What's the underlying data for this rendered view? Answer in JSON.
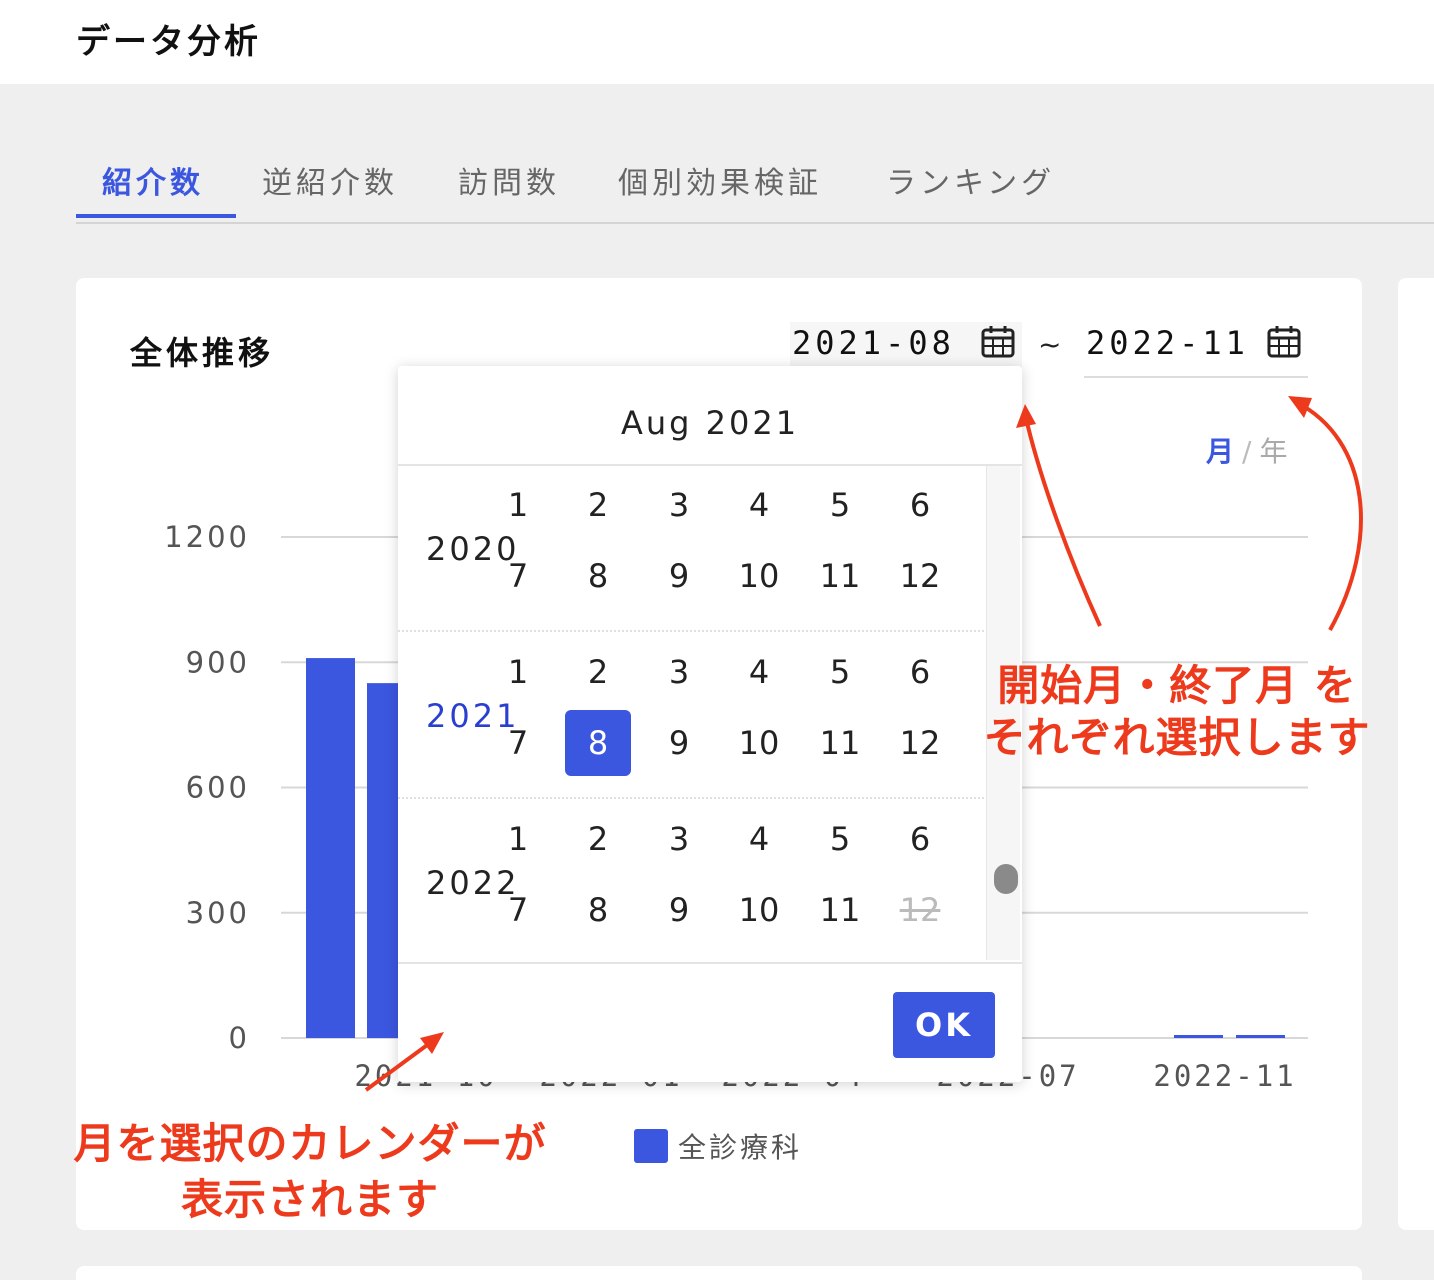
{
  "app": {
    "title": "データ分析"
  },
  "tabs": [
    {
      "label": "紹介数",
      "active": true
    },
    {
      "label": "逆紹介数",
      "active": false
    },
    {
      "label": "訪問数",
      "active": false
    },
    {
      "label": "個別効果検証",
      "active": false
    },
    {
      "label": "ランキング",
      "active": false
    }
  ],
  "card": {
    "title": "全体推移",
    "range": {
      "start": "2021-08",
      "separator": "~",
      "end": "2022-11"
    },
    "period_toggle": {
      "month": "月",
      "divider": "/",
      "year": "年",
      "selected": "月"
    }
  },
  "chart_data": {
    "type": "bar",
    "y_ticks": [
      "1200",
      "900",
      "600",
      "300",
      "0"
    ],
    "ylim": [
      0,
      1200
    ],
    "x_ticks": [
      "2021-10",
      "2022-01",
      "2022-04",
      "2022-07",
      "2022-11"
    ],
    "visible_values": [
      {
        "x": "2021-08",
        "y": 910
      },
      {
        "x": "2021-09",
        "y": 850
      },
      {
        "x": "2022-10",
        "y": 0
      },
      {
        "x": "2022-11",
        "y": 0
      }
    ],
    "series": [
      {
        "name": "全診療科",
        "color": "#3b57e0"
      }
    ],
    "grid": true,
    "legend": "bottom-center"
  },
  "calendar": {
    "header": "Aug 2021",
    "years": [
      {
        "year": "2020",
        "months": [
          "1",
          "2",
          "3",
          "4",
          "5",
          "6",
          "7",
          "8",
          "9",
          "10",
          "11",
          "12"
        ]
      },
      {
        "year": "2021",
        "months": [
          "1",
          "2",
          "3",
          "4",
          "5",
          "6",
          "7",
          "8",
          "9",
          "10",
          "11",
          "12"
        ],
        "current": true,
        "selected_month": "8"
      },
      {
        "year": "2022",
        "months": [
          "1",
          "2",
          "3",
          "4",
          "5",
          "6",
          "7",
          "8",
          "9",
          "10",
          "11",
          "12"
        ],
        "disabled_months": [
          "12"
        ]
      }
    ],
    "ok_label": "OK"
  },
  "annotations": {
    "right_line1": "開始月・終了月 を",
    "right_line2": "それぞれ選択します",
    "bottom_line1": "月を選択のカレンダーが",
    "bottom_line2": "表示されます",
    "color": "#ee3a1c"
  },
  "colors": {
    "accent": "#3b57e0",
    "annotation": "#ee3a1c"
  }
}
